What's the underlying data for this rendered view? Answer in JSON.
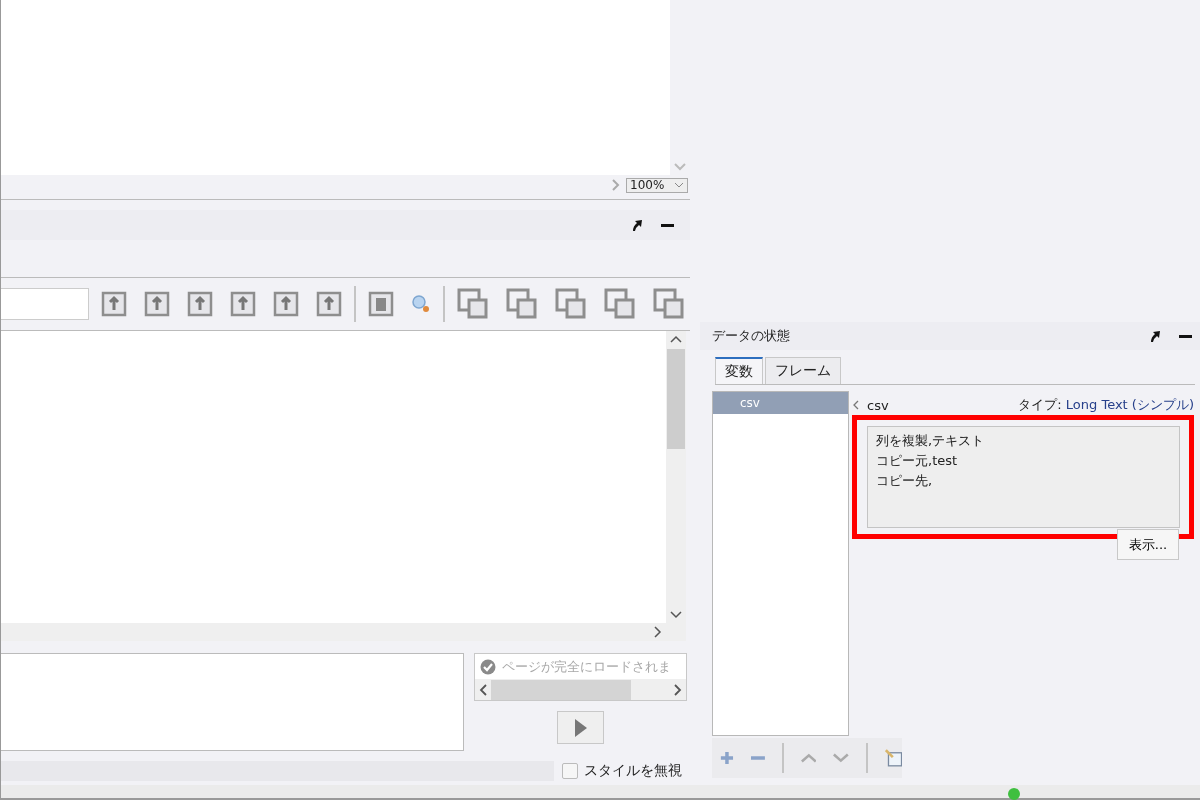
{
  "preview": {
    "zoom": "100%"
  },
  "status": {
    "message": "ページが完全にロードされま"
  },
  "options": {
    "ignore_styles": {
      "label": "スタイルを無視",
      "checked": false
    }
  },
  "data_panel": {
    "title": "データの状態",
    "tabs": [
      {
        "label": "変数",
        "selected": true
      },
      {
        "label": "フレーム",
        "selected": false
      }
    ],
    "variables": [
      {
        "name": "csv",
        "selected": true
      }
    ],
    "detail": {
      "name": "csv",
      "type_label": "タイプ:",
      "type_value": "Long Text (シンプル)",
      "highlighted": true,
      "lines": [
        "列を複製,テキスト",
        "コピー元,test",
        "コピー先,"
      ],
      "show_button": "表示..."
    }
  }
}
